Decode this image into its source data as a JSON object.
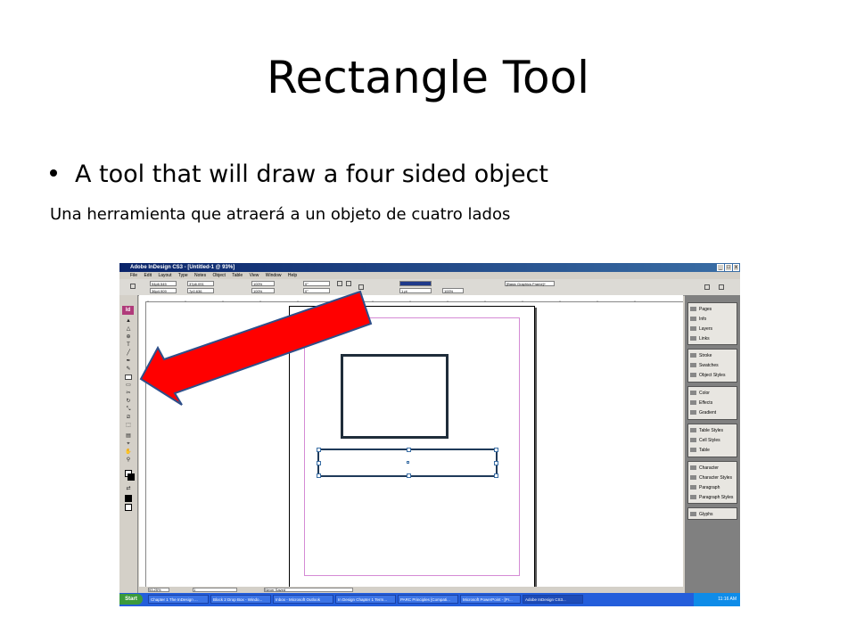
{
  "slide": {
    "title": "Rectangle Tool",
    "bullet": "A tool that will draw a four sided object",
    "subline": "Una herramienta que atraerá a un objeto de cuatro lados"
  },
  "app": {
    "title": "Adobe InDesign CS3 - [Untitled-1 @ 93%]",
    "logo": "Id",
    "menu": [
      "File",
      "Edit",
      "Layout",
      "Type",
      "Notes",
      "Object",
      "Table",
      "View",
      "Window",
      "Help"
    ],
    "control": {
      "x_value": "54p6.545",
      "y_value": "36p4.909",
      "w_value": "37p6.091",
      "h_value": "7p0.636",
      "scale_x": "100%",
      "scale_y": "100%",
      "rotate": "0°",
      "shear": "0°",
      "stroke_weight": "1 pt",
      "opacity": "100%",
      "frame_style": "[Basic Graphics Frame]+"
    },
    "ruler_ticks": [
      "0",
      "6",
      "12",
      "18",
      "24",
      "30",
      "36",
      "42",
      "48",
      "54",
      "60",
      "66",
      "72",
      "78"
    ],
    "status": {
      "zoom": "93.25%",
      "page": "1",
      "saved": "Never Saved"
    },
    "panels": [
      {
        "items": [
          "Pages",
          "Info",
          "Layers",
          "Links"
        ]
      },
      {
        "items": [
          "Stroke",
          "Swatches",
          "Object Styles"
        ]
      },
      {
        "items": [
          "Color",
          "Effects",
          "Gradient"
        ]
      },
      {
        "items": [
          "Table Styles",
          "Cell Styles",
          "Table"
        ]
      },
      {
        "items": [
          "Character",
          "Character Styles",
          "Paragraph",
          "Paragraph Styles"
        ]
      },
      {
        "items": [
          "Glyphs"
        ]
      }
    ],
    "taskbar": {
      "start": "Start",
      "tasks": [
        "Chapter 1 The InDesign ...",
        "Block 2 Drop Box - Windo...",
        "Inbox - Microsoft Outlook",
        "In Design Chapter 1 Term...",
        "PARC Principles [Compati...",
        "Microsoft PowerPoint - [Pr...",
        "Adobe InDesign CS3..."
      ],
      "time": "11:16 AM"
    }
  },
  "colors": {
    "arrow_fill": "#ff0000",
    "arrow_stroke": "#2e4f8a",
    "margin_guide": "#d58bd5",
    "title_bar": "#0a246a"
  }
}
